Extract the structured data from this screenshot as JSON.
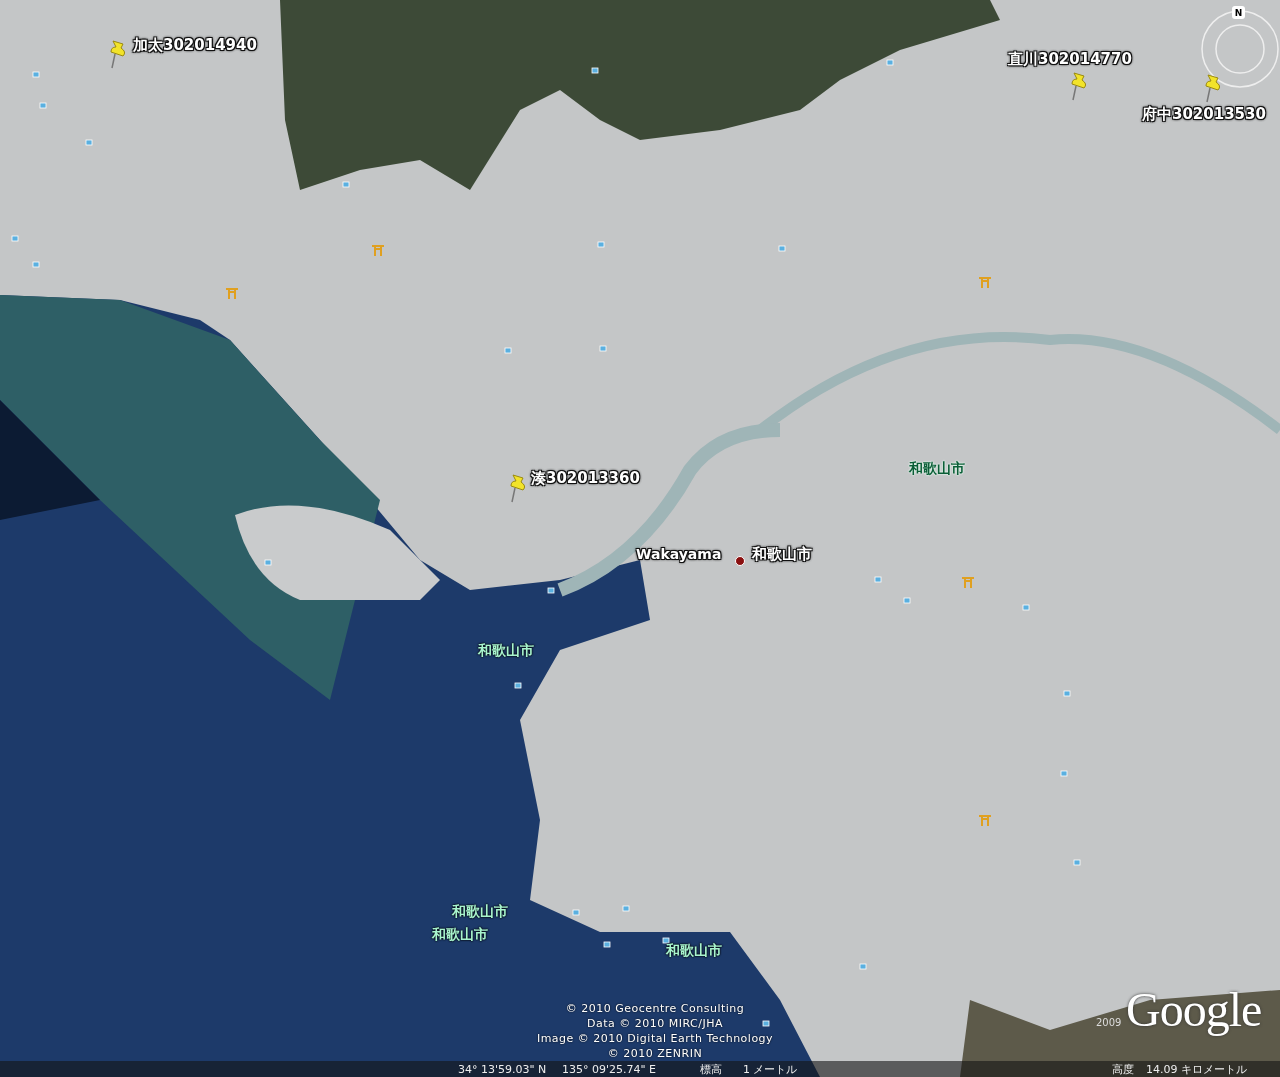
{
  "placemarks": [
    {
      "label": "加太302014940"
    },
    {
      "label": "直川302014770"
    },
    {
      "label": "府中302013530"
    },
    {
      "label": "湊302013360"
    }
  ],
  "place_labels": [
    {
      "label": "和歌山市"
    },
    {
      "label": "和歌山市"
    },
    {
      "label": "和歌山市"
    },
    {
      "label": "和歌山市"
    },
    {
      "label": "和歌山市"
    }
  ],
  "city": {
    "romaji": "Wakayama",
    "name": "和歌山市"
  },
  "compass": {
    "north": "N"
  },
  "attribution": [
    "© 2010 Geocentre Consulting",
    "Data © 2010 MIRC/JHA",
    "Image © 2010 Digital Earth Technology",
    "© 2010 ZENRIN"
  ],
  "logo": {
    "year": "2009",
    "text": "Google"
  },
  "status_bar": {
    "latitude": "34° 13'59.03\" N",
    "longitude": "135° 09'25.74\" E",
    "elevation_label": "標高",
    "elevation": "1 メートル",
    "altitude_label": "高度",
    "altitude": "14.09 キロメートル"
  }
}
